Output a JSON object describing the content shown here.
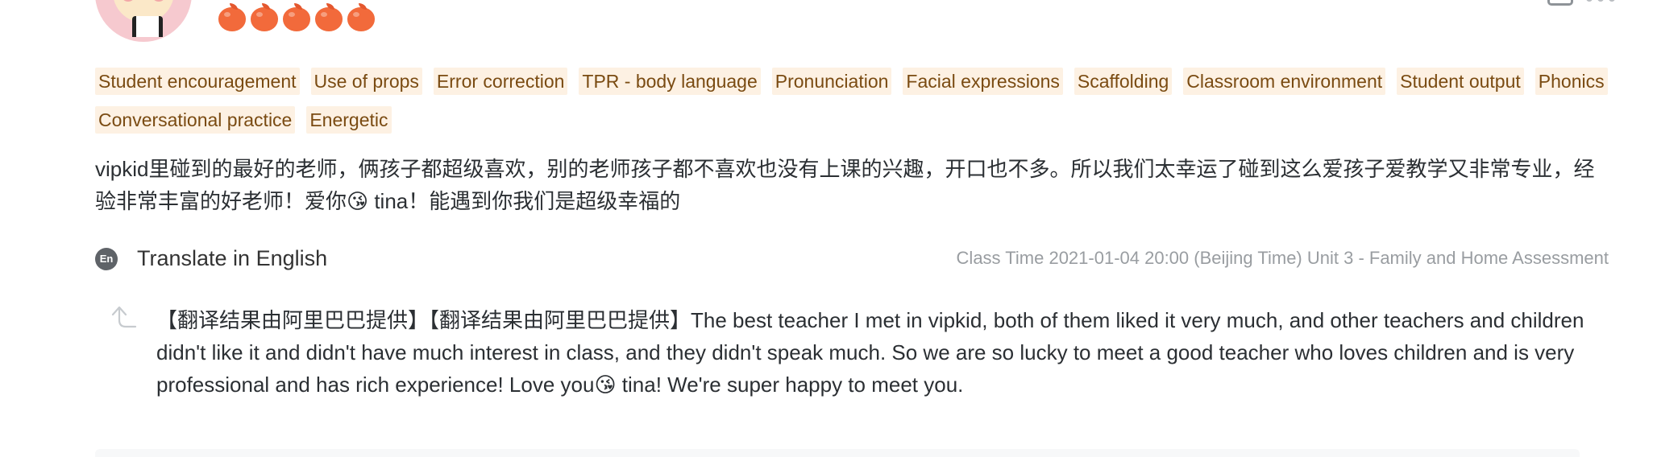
{
  "review": {
    "rating_count": 5,
    "rating_icon": "apple-icon",
    "tags": [
      "Student encouragement",
      "Use of props",
      "Error correction",
      "TPR - body language",
      "Pronunciation",
      "Facial expressions",
      "Scaffolding",
      "Classroom environment",
      "Student output",
      "Phonics",
      "Conversational practice",
      "Energetic"
    ],
    "comment": "vipkid里碰到的最好的老师，俩孩子都超级喜欢，别的老师孩子都不喜欢也没有上课的兴趣，开口也不多。所以我们太幸运了碰到这么爱孩子爱教学又非常专业，经验非常丰富的好老师！爱你😘 tina！能遇到你我们是超级幸福的",
    "translate_badge": "En",
    "translate_label": "Translate in English",
    "class_time": "Class Time 2021-01-04 20:00 (Beijing Time) Unit 3 - Family and Home Assessment",
    "translation": "【翻译结果由阿里巴巴提供】【翻译结果由阿里巴巴提供】The best teacher I met in vipkid, both of them liked it very much, and other teachers and children didn't like it and didn't have much interest in class, and they didn't speak much. So we are so lucky to meet a good teacher who loves children and is very professional and has rich experience! Love you😘 tina! We're super happy to meet you."
  },
  "colors": {
    "tag_background": "#fdf1e3",
    "tag_text": "#7a4b12",
    "rating_apple": "#f26a3b",
    "muted_text": "#999da1",
    "body_text": "#2b2f33"
  }
}
